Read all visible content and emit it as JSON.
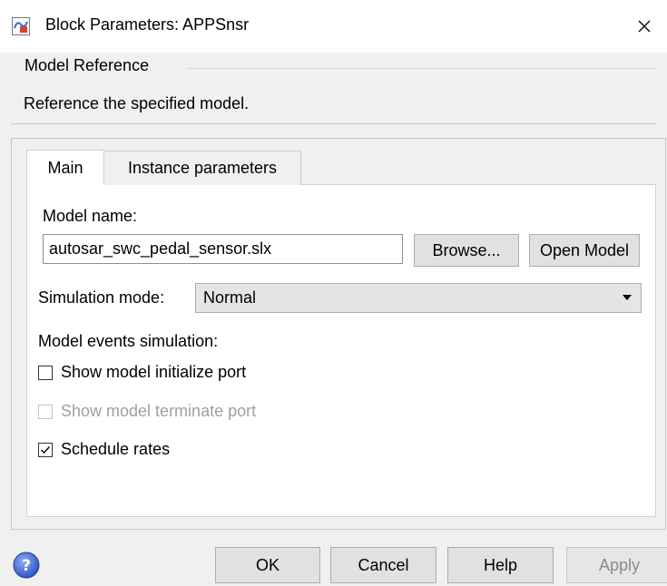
{
  "window": {
    "title": "Block Parameters: APPSnsr",
    "app_icon": "simulink-block-icon",
    "close_icon": "close-icon"
  },
  "group": {
    "label": "Model Reference",
    "description": "Reference the specified model."
  },
  "tabs": [
    {
      "label": "Main",
      "active": true
    },
    {
      "label": "Instance parameters",
      "active": false
    }
  ],
  "main": {
    "model_name_label": "Model name:",
    "model_name_value": "autosar_swc_pedal_sensor.slx",
    "browse_label": "Browse...",
    "open_model_label": "Open Model",
    "sim_mode_label": "Simulation mode:",
    "sim_mode_value": "Normal",
    "events_label": "Model events simulation:",
    "checkboxes": [
      {
        "label": "Show model initialize port",
        "checked": false,
        "enabled": true
      },
      {
        "label": "Show model terminate port",
        "checked": false,
        "enabled": false
      },
      {
        "label": "Schedule rates",
        "checked": true,
        "enabled": true
      }
    ]
  },
  "footer": {
    "help_icon": "help-icon",
    "ok_label": "OK",
    "cancel_label": "Cancel",
    "help_label": "Help",
    "apply_label": "Apply"
  },
  "colors": {
    "dialog_bg": "#f0f0f0",
    "panel_bg": "#ffffff",
    "button_bg": "#e1e1e1",
    "help_icon_blue": "#3f6ad8"
  }
}
